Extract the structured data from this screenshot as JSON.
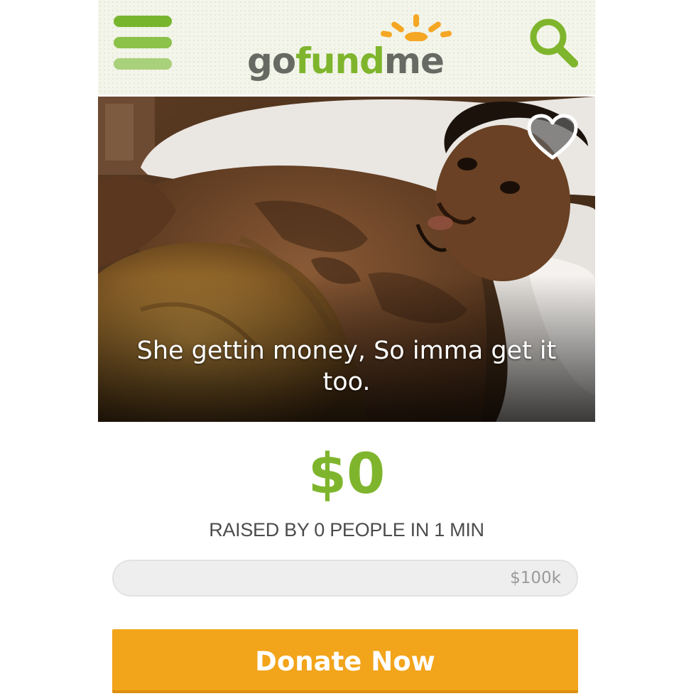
{
  "header": {
    "logo": {
      "go": "go",
      "fund": "fund",
      "me": "me"
    },
    "menu_icon": "hamburger-menu-icon",
    "search_icon": "search-icon"
  },
  "campaign": {
    "photo_icon": "heart-icon",
    "caption_line1": "She gettin money, So imma get it",
    "caption_line2": "too.",
    "amount": "$0",
    "raised_text": "RAISED BY 0 PEOPLE IN 1 MIN",
    "goal_label": "$100k",
    "progress_fraction": 0,
    "donate_label": "Donate Now"
  },
  "colors": {
    "brand_green": "#7fb52d",
    "donate_orange": "#f2a41a",
    "text_gray": "#4c4c4c"
  }
}
